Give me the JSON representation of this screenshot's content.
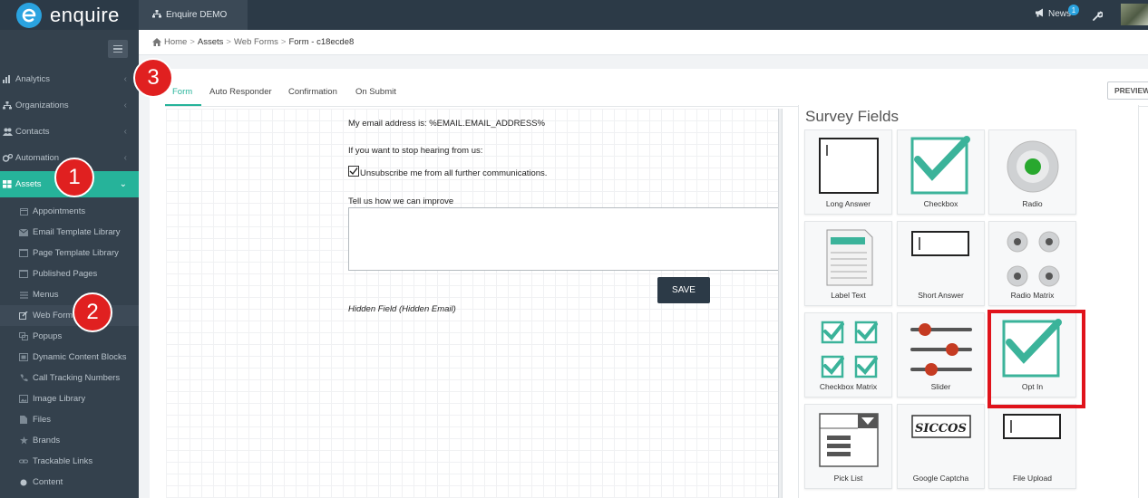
{
  "app": {
    "brand": "enquire",
    "account_tab": "Enquire DEMO",
    "news_label": "News",
    "news_count": "1"
  },
  "sidebar": {
    "items": [
      {
        "label": "Analytics",
        "icon": "chart-icon"
      },
      {
        "label": "Organizations",
        "icon": "sitemap-icon"
      },
      {
        "label": "Contacts",
        "icon": "users-icon"
      },
      {
        "label": "Automation",
        "icon": "gears-icon"
      },
      {
        "label": "Assets",
        "icon": "grid-icon",
        "active": true
      }
    ],
    "sub_items": [
      {
        "label": "Appointments",
        "icon": "calendar-icon"
      },
      {
        "label": "Email Template Library",
        "icon": "envelope-icon"
      },
      {
        "label": "Page Template Library",
        "icon": "page-icon"
      },
      {
        "label": "Published Pages",
        "icon": "pages-icon"
      },
      {
        "label": "Menus",
        "icon": "list-icon"
      },
      {
        "label": "Web Forms",
        "icon": "edit-icon",
        "current": true
      },
      {
        "label": "Popups",
        "icon": "popup-icon"
      },
      {
        "label": "Dynamic Content Blocks",
        "icon": "blocks-icon"
      },
      {
        "label": "Call Tracking Numbers",
        "icon": "phone-icon"
      },
      {
        "label": "Image Library",
        "icon": "image-icon"
      },
      {
        "label": "Files",
        "icon": "file-icon"
      },
      {
        "label": "Brands",
        "icon": "star-icon"
      },
      {
        "label": "Trackable Links",
        "icon": "link-icon"
      },
      {
        "label": "Content",
        "icon": "dot-icon"
      }
    ]
  },
  "annotations": {
    "one": "1",
    "two": "2",
    "three": "3"
  },
  "breadcrumb": {
    "home": "Home",
    "assets": "Assets",
    "web_forms": "Web Forms",
    "current": "Form - c18ecde8"
  },
  "tabs": [
    "Form",
    "Auto Responder",
    "Confirmation",
    "On Submit"
  ],
  "preview_label": "PREVIEW",
  "form": {
    "email_line": "My email address is: %EMAIL.EMAIL_ADDRESS%",
    "stop_line": "If you want to stop hearing from us:",
    "unsubscribe_label": "Unsubscribe me from all further communications.",
    "unsubscribe_checked": true,
    "improve_label": "Tell us how we can improve",
    "improve_value": "",
    "save_label": "SAVE",
    "hidden_field_label": "Hidden Field (Hidden Email)"
  },
  "survey": {
    "title": "Survey Fields",
    "fields": [
      "Long Answer",
      "Checkbox",
      "Radio",
      "Label Text",
      "Short Answer",
      "Radio Matrix",
      "Checkbox Matrix",
      "Slider",
      "Opt In",
      "Pick List",
      "Google Captcha",
      "File Upload"
    ],
    "highlighted": "Opt In"
  },
  "colors": {
    "accent": "#26b39a",
    "topbar": "#2c3a47",
    "sidebar": "#34414d",
    "highlight": "#e0131b"
  }
}
